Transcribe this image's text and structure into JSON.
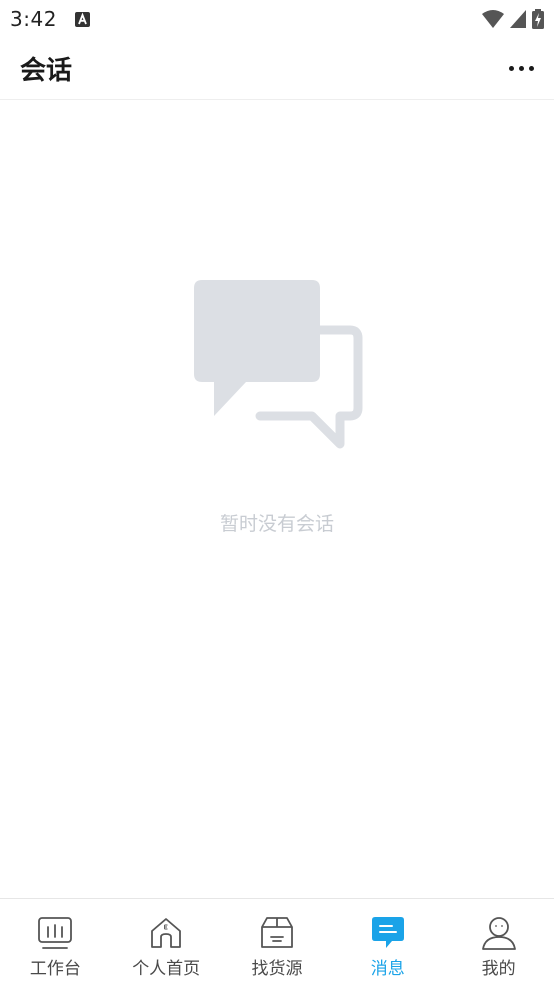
{
  "status_bar": {
    "time": "3:42",
    "notification_icon": "a-keyboard-icon",
    "wifi_icon": "wifi-icon",
    "signal_icon": "cell-signal-icon",
    "battery_icon": "battery-charging-icon"
  },
  "header": {
    "title": "会话",
    "more_icon": "more-horizontal-icon"
  },
  "empty_state": {
    "icon": "chat-bubbles-icon",
    "message": "暂时没有会话"
  },
  "bottom_nav": {
    "items": [
      {
        "label": "工作台",
        "icon": "dashboard-icon",
        "active": false
      },
      {
        "label": "个人首页",
        "icon": "home-icon",
        "active": false
      },
      {
        "label": "找货源",
        "icon": "package-box-icon",
        "active": false
      },
      {
        "label": "消息",
        "icon": "message-icon",
        "active": true
      },
      {
        "label": "我的",
        "icon": "user-icon",
        "active": false
      }
    ],
    "active_color": "#1aa3e8",
    "inactive_color": "#4a4a4a"
  },
  "colors": {
    "empty_icon": "#dcdfe4",
    "empty_text": "#c8ccd2"
  }
}
